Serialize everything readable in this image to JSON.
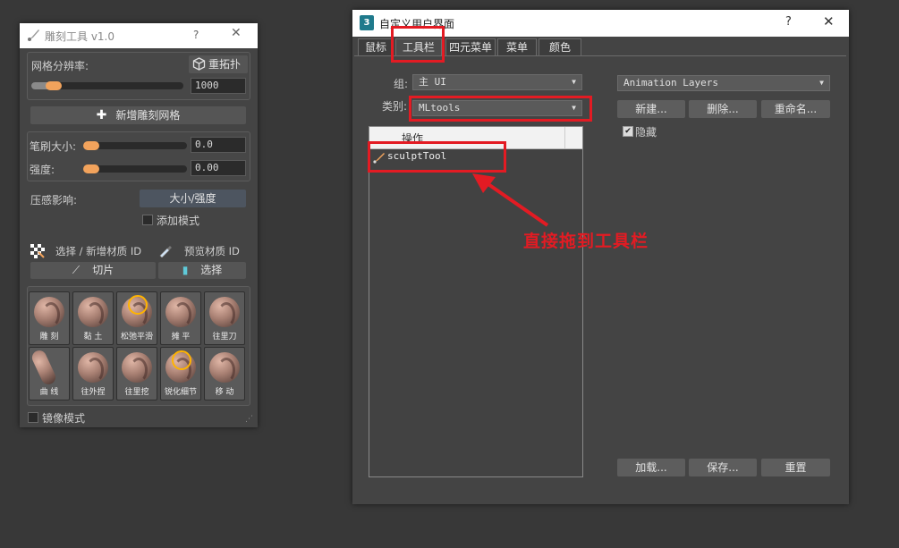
{
  "sculpt_panel": {
    "title": "雕刻工具 v1.0",
    "help_glyph": "?",
    "close_glyph": "✕",
    "mesh_resolution_label": "网格分辨率:",
    "retopo_label": "重拓扑",
    "mesh_resolution_value": "1000",
    "mesh_resolution_fraction": 0.18,
    "add_sculpt_mesh_label": "新增雕刻网格",
    "brush_size_label": "笔刷大小:",
    "brush_size_value": "0.0",
    "strength_label": "强度:",
    "strength_value": "0.00",
    "pressure_label": "压感影响:",
    "pressure_mode": "大小/强度",
    "additive_mode_label": "添加模式",
    "select_add_material_label": "选择 / 新增材质 ID",
    "preview_material_label": "预览材质 ID",
    "slice_label": "切片",
    "select_label": "选择",
    "tools": [
      {
        "label": "雕 刻"
      },
      {
        "label": "黏 土"
      },
      {
        "label": "松弛平滑"
      },
      {
        "label": "摊 平"
      },
      {
        "label": "往里刀"
      },
      {
        "label": "曲 线"
      },
      {
        "label": "往外捏"
      },
      {
        "label": "往里挖"
      },
      {
        "label": "锐化细节"
      },
      {
        "label": "移 动"
      }
    ],
    "mirror_mode_label": "镜像模式"
  },
  "customize_dialog": {
    "app_icon_text": "3",
    "title": "自定义用户界面",
    "help_glyph": "?",
    "close_glyph": "✕",
    "tabs": [
      "鼠标",
      "工具栏",
      "四元菜单",
      "菜单",
      "颜色"
    ],
    "group_label": "组:",
    "group_value": "主 UI",
    "category_label": "类别:",
    "category_value": "MLtools",
    "list_header": "操作",
    "list_items": [
      "sculptTool"
    ],
    "toolbar_dropdown_value": "Animation Layers",
    "new_button": "新建...",
    "delete_button": "删除...",
    "rename_button": "重命名...",
    "hide_label": "隐藏",
    "hide_checked": true,
    "load_button": "加载...",
    "save_button": "保存...",
    "reset_button": "重置"
  },
  "annotation": {
    "text": "直接拖到工具栏",
    "color": "#e31b23"
  }
}
